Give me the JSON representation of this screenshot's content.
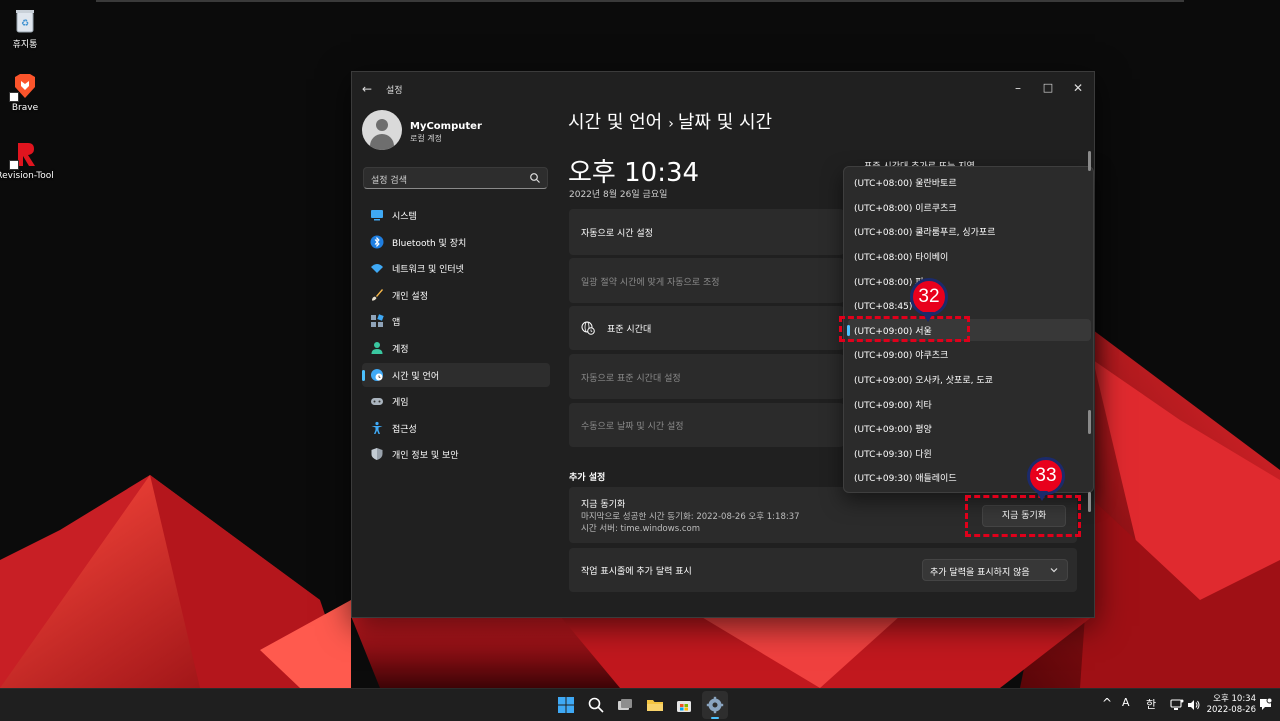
{
  "desktop": {
    "icons": [
      {
        "label": "휴지통"
      },
      {
        "label": "Brave"
      },
      {
        "label": "Revision-Tool"
      }
    ]
  },
  "window": {
    "title": "설정",
    "controls": {
      "minimize": "–",
      "maximize": "□",
      "close": "✕"
    }
  },
  "profile": {
    "name": "MyComputer",
    "subtitle": "로컬 계정"
  },
  "search": {
    "placeholder": "설정 검색"
  },
  "nav": [
    {
      "label": "시스템",
      "icon": "monitor-icon"
    },
    {
      "label": "Bluetooth 및 장치",
      "icon": "bluetooth-icon"
    },
    {
      "label": "네트워크 및 인터넷",
      "icon": "wifi-icon"
    },
    {
      "label": "개인 설정",
      "icon": "brush-icon"
    },
    {
      "label": "앱",
      "icon": "apps-icon"
    },
    {
      "label": "계정",
      "icon": "person-icon"
    },
    {
      "label": "시간 및 언어",
      "icon": "globe-clock-icon",
      "active": true
    },
    {
      "label": "게임",
      "icon": "gamepad-icon"
    },
    {
      "label": "접근성",
      "icon": "accessibility-icon"
    },
    {
      "label": "개인 정보 및 보안",
      "icon": "shield-icon"
    }
  ],
  "breadcrumb": {
    "parent": "시간 및 언어",
    "separator": "›",
    "current": "날짜 및 시간"
  },
  "clock": {
    "time": "오후 10:34",
    "date": "2022년 8월 26일 금요일"
  },
  "partial_header": "표준 시간대     추가로 또는 지역",
  "cards": {
    "auto_time": "자동으로 시간 설정",
    "dst": "일광 절약 시간에 맞게 자동으로 조정",
    "timezone": "표준 시간대",
    "auto_timezone": "자동으로 표준 시간대 설정",
    "manual": "수동으로 날짜 및 시간 설정"
  },
  "additional": {
    "section_title": "추가 설정",
    "sync_title": "지금 동기화",
    "sync_last": "마지막으로 성공한 시간 동기화: 2022-08-26 오후 1:18:37",
    "sync_server": "시간 서버: time.windows.com",
    "sync_button": "지금 동기화",
    "calendar_label": "작업 표시줄에 추가 달력 표시",
    "calendar_value": "추가 달력을 표시하지 않음"
  },
  "timezone_options": [
    {
      "label": "(UTC+08:00) 울란바토르"
    },
    {
      "label": "(UTC+08:00) 이르쿠츠크"
    },
    {
      "label": "(UTC+08:00) 쿨라룸푸르, 싱가포르"
    },
    {
      "label": "(UTC+08:00) 타이베이"
    },
    {
      "label": "(UTC+08:00) 퍼"
    },
    {
      "label": "(UTC+08:45) 유"
    },
    {
      "label": "(UTC+09:00) 서울",
      "selected": true
    },
    {
      "label": "(UTC+09:00) 야쿠츠크"
    },
    {
      "label": "(UTC+09:00) 오사카, 삿포로, 도쿄"
    },
    {
      "label": "(UTC+09:00) 치타"
    },
    {
      "label": "(UTC+09:00) 평양"
    },
    {
      "label": "(UTC+09:30) 다윈"
    },
    {
      "label": "(UTC+09:30) 애들레이드"
    }
  ],
  "annotations": {
    "badge1": "32",
    "badge2": "33"
  },
  "taskbar": {
    "tray": {
      "chevron": "^",
      "ime1": "A",
      "ime2": "한"
    },
    "clock_time": "오후 10:34",
    "clock_date": "2022-08-26"
  },
  "colors": {
    "accent": "#4cc2ff",
    "annotation_red": "#e0001b",
    "badge_border": "#1b2a6b"
  }
}
